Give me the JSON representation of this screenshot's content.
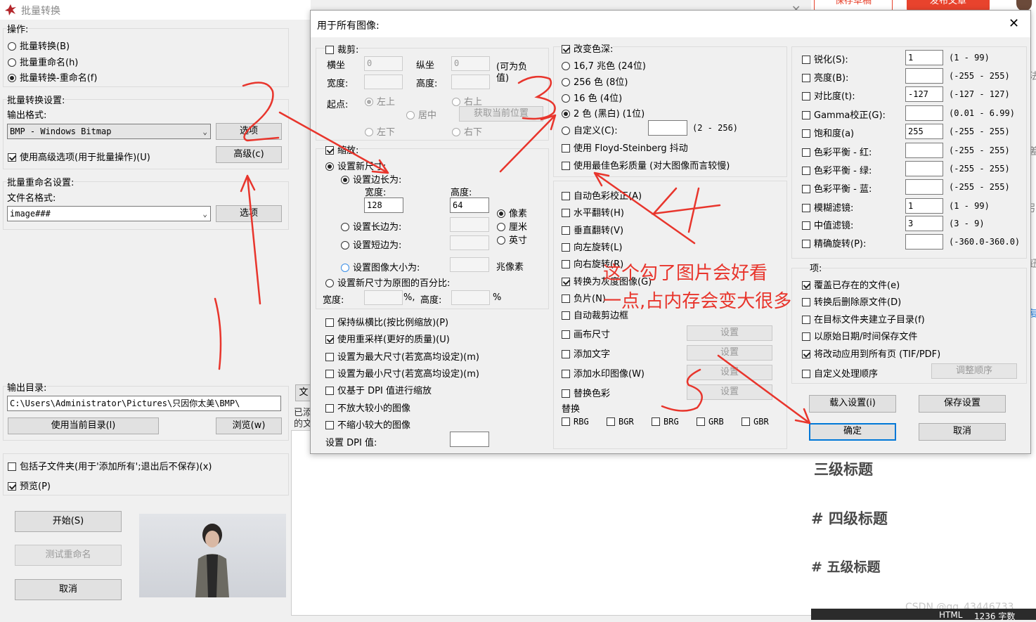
{
  "colors": {
    "dialog_bg": "#f0f0f0",
    "accent": "#0078d7",
    "annotation": "#e8352c",
    "editor_red": "#e8432d"
  },
  "main": {
    "title": "批量转换",
    "icon": "app-logo-icon",
    "operations": {
      "label": "操作:",
      "opt1": "批量转换(B)",
      "opt2": "批量重命名(h)",
      "opt3": "批量转换-重命名(f)"
    },
    "conv": {
      "label": "批量转换设置:",
      "format_label": "输出格式:",
      "format_value": "BMP - Windows Bitmap",
      "options_btn": "选项",
      "advanced_check": "使用高级选项(用于批量操作)(U)",
      "advanced_btn": "高级(c)"
    },
    "rename": {
      "label": "批量重命名设置:",
      "pattern_label": "文件名格式:",
      "pattern_value": "image###",
      "options_btn": "选项"
    },
    "output": {
      "label": "输出目录:",
      "path": "C:\\Users\\Administrator\\Pictures\\只因你太美\\BMP\\",
      "use_current_btn": "使用当前目录(l)",
      "browse_btn": "浏览(w)"
    },
    "subfolders": "包括子文件夹(用于'添加所有';退出后不保存)(x)",
    "preview": "预览(P)",
    "start_btn": "开始(S)",
    "test_btn": "测试重命名",
    "cancel_btn": "取消",
    "partial_status": "已添",
    "partial_status2": "的文",
    "partial_btn": "文"
  },
  "dialog": {
    "title": "用于所有图像:",
    "crop": {
      "label": "裁剪:",
      "x_label": "横坐",
      "y_label": "纵坐",
      "x_val": "0",
      "y_val": "0",
      "neg_note": "(可为负值)",
      "w_label": "宽度:",
      "h_label": "高度:",
      "origin_label": "起点:",
      "tl": "左上",
      "tr": "右上",
      "center": "居中",
      "get_pos_btn": "获取当前位置",
      "bl": "左下",
      "br": "右下"
    },
    "resize": {
      "label": "缩放:",
      "set_new": "设置新尺寸:",
      "set_side": "设置边长为:",
      "w_label": "宽度:",
      "h_label": "高度:",
      "w_val": "128",
      "h_val": "64",
      "unit_px": "像素",
      "unit_cm": "厘米",
      "unit_in": "英寸",
      "long_side": "设置长边为:",
      "short_side": "设置短边为:",
      "img_size": "设置图像大小为:",
      "mp": "兆像素",
      "percent": "设置新尺寸为原图的百分比:",
      "pw_label": "宽度:",
      "pct1": "%,",
      "ph_label": "高度:",
      "pct2": "%"
    },
    "options": {
      "keep_ratio": "保持纵横比(按比例缩放)(P)",
      "resample": "使用重采样(更好的质量)(U)",
      "as_max": "设置为最大尺寸(若宽高均设定)(m)",
      "as_min": "设置为最小尺寸(若宽高均设定)(m)",
      "dpi_only": "仅基于 DPI 值进行缩放",
      "no_enlarge": "不放大较小的图像",
      "no_shrink": "不缩小较大的图像",
      "set_dpi": "设置 DPI 值:"
    },
    "color_depth": {
      "label": "改变色深:",
      "d24": "16,7 兆色 (24位)",
      "d8": "256 色 (8位)",
      "d4": "16 色 (4位)",
      "d1": "2 色 (黑白) (1位)",
      "custom": "自定义(C):",
      "custom_range": "(2 - 256)",
      "floyd": "使用 Floyd-Steinberg 抖动",
      "best": "使用最佳色彩质量 (对大图像而言较慢)"
    },
    "transforms": {
      "auto_color": "自动色彩校正(A)",
      "hflip": "水平翻转(H)",
      "vflip": "垂直翻转(V)",
      "rot_left": "向左旋转(L)",
      "rot_right": "向右旋转(R)",
      "gray": "转换为灰度图像(G)",
      "negative": "负片(N)",
      "auto_crop": "自动裁剪边框",
      "canvas": "画布尺寸",
      "add_text": "添加文字",
      "watermark": "添加水印图像(W)",
      "replace_color": "替换色彩",
      "set_btn": "设置",
      "swap_label": "替换",
      "swaps": [
        "RBG",
        "BGR",
        "BRG",
        "GRB",
        "GBR"
      ]
    },
    "adjust": [
      {
        "label": "锐化(S):",
        "value": "1",
        "range": "(1 - 99)"
      },
      {
        "label": "亮度(B):",
        "value": "",
        "range": "(-255 - 255)"
      },
      {
        "label": "对比度(t):",
        "value": "-127",
        "range": "(-127 - 127)"
      },
      {
        "label": "Gamma校正(G):",
        "value": "",
        "range": "(0.01 - 6.99)"
      },
      {
        "label": "饱和度(a)",
        "value": "255",
        "range": "(-255 - 255)"
      },
      {
        "label": "色彩平衡 - 红:",
        "value": "",
        "range": "(-255 - 255)"
      },
      {
        "label": "色彩平衡 - 绿:",
        "value": "",
        "range": "(-255 - 255)"
      },
      {
        "label": "色彩平衡 - 蓝:",
        "value": "",
        "range": "(-255 - 255)"
      },
      {
        "label": "模糊滤镜:",
        "value": "1",
        "range": "(1 - 99)"
      },
      {
        "label": "中值滤镜:",
        "value": "3",
        "range": "(3 - 9)"
      },
      {
        "label": "精确旋转(P):",
        "value": "",
        "range": "(-360.0-360.0)"
      }
    ],
    "misc": {
      "label": "项:",
      "overwrite": "覆盖已存在的文件(e)",
      "delete_orig": "转换后删除原文件(D)",
      "subdir": "在目标文件夹建立子目录(f)",
      "keep_date": "以原始日期/时间保存文件",
      "apply_pages": "将改动应用到所有页 (TIF/PDF)",
      "custom_order": "自定义处理顺序",
      "order_btn": "调整顺序"
    },
    "load_btn": "载入设置(i)",
    "save_btn": "保存设置",
    "ok_btn": "确定",
    "cancel_btn": "取消"
  },
  "annotations": {
    "n1": "1",
    "n2": "2",
    "n3": "3",
    "n4": "4",
    "n5": "5",
    "note_line1": "这个勾了图片会好看",
    "note_line2": "一点,占内存会变大很多"
  },
  "editor": {
    "btn1": "保存草稿",
    "btn2": "发布文章",
    "h3": "三级标题",
    "h4": "# 四级标题",
    "h5": "# 五级标题",
    "status_html": "HTML",
    "status_count": "1236 字数",
    "watermark": "CSDN @qq_43446733",
    "sliver_glyphs": [
      "法",
      "差",
      "引",
      "钮",
      "复"
    ]
  }
}
